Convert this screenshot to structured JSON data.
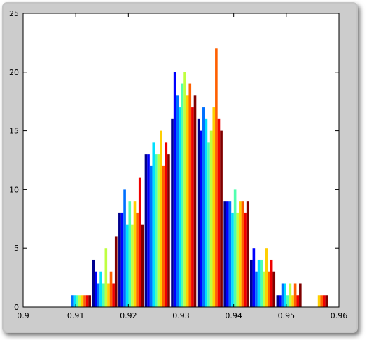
{
  "figure": {
    "background_color": "#cccccc",
    "axes_color": "#ffffff"
  },
  "chart_data": {
    "type": "bar",
    "title": "",
    "xlabel": "",
    "ylabel": "",
    "xlim": [
      0.9,
      0.96
    ],
    "ylim": [
      0,
      25
    ],
    "grid": false,
    "legend": "none",
    "xticks": [
      "0.9",
      "0.91",
      "0.92",
      "0.93",
      "0.94",
      "0.95",
      "0.96"
    ],
    "yticks": [
      "0",
      "5",
      "10",
      "15",
      "20",
      "25"
    ],
    "bin_centers": [
      0.9105,
      0.9155,
      0.9205,
      0.9255,
      0.9305,
      0.9355,
      0.9405,
      0.9455,
      0.9505,
      0.9555
    ],
    "colormap": [
      "#00008f",
      "#0000ff",
      "#0070ff",
      "#00dfff",
      "#50ffaf",
      "#bfff40",
      "#ffcf00",
      "#ff6000",
      "#ef0000",
      "#7f0000"
    ],
    "series": [
      {
        "values": [
          0,
          4,
          8,
          13,
          16,
          16,
          9,
          4,
          1,
          0
        ]
      },
      {
        "values": [
          0,
          3,
          8,
          13,
          20,
          15,
          9,
          5,
          1,
          0
        ]
      },
      {
        "values": [
          1,
          2,
          10,
          12,
          18,
          17,
          9,
          3,
          2,
          0
        ]
      },
      {
        "values": [
          1,
          3,
          7,
          14,
          17,
          16,
          8,
          4,
          2,
          0
        ]
      },
      {
        "values": [
          1,
          2,
          9,
          13,
          19,
          14,
          10,
          4,
          1,
          0
        ]
      },
      {
        "values": [
          1,
          5,
          7,
          13,
          20,
          15,
          8,
          3,
          2,
          0
        ]
      },
      {
        "values": [
          1,
          2,
          9,
          15,
          18,
          17,
          9,
          5,
          1,
          1
        ]
      },
      {
        "values": [
          1,
          3,
          8,
          12,
          19,
          22,
          9,
          3,
          2,
          1
        ]
      },
      {
        "values": [
          1,
          2,
          11,
          14,
          17,
          16,
          8,
          4,
          1,
          1
        ]
      },
      {
        "values": [
          1,
          6,
          7,
          13,
          18,
          15,
          9,
          3,
          2,
          1
        ]
      }
    ]
  }
}
